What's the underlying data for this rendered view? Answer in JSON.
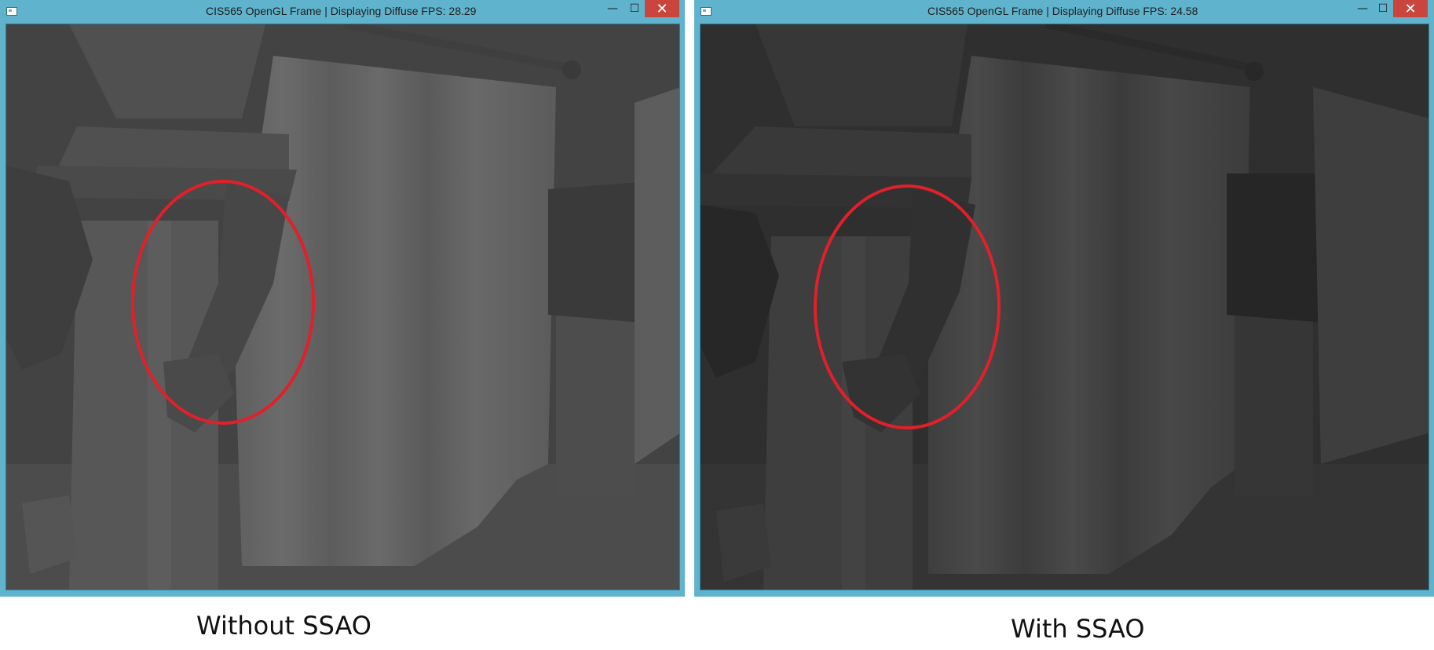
{
  "windows": [
    {
      "title": "CIS565 OpenGL Frame | Displaying Diffuse FPS: 28.29",
      "controls": {
        "minimize": "—",
        "maximize": "☐",
        "close": "✕"
      },
      "caption": "Without SSAO",
      "theme": {
        "titlebar": "#5fb3cd",
        "close_button": "#c9453d",
        "highlight_ring": "#e0202a"
      }
    },
    {
      "title": "CIS565 OpenGL Frame | Displaying Diffuse FPS: 24.58",
      "controls": {
        "minimize": "—",
        "maximize": "☐",
        "close": "✕"
      },
      "caption": "With SSAO",
      "theme": {
        "titlebar": "#5fb3cd",
        "close_button": "#c9453d",
        "highlight_ring": "#e0202a"
      }
    }
  ]
}
